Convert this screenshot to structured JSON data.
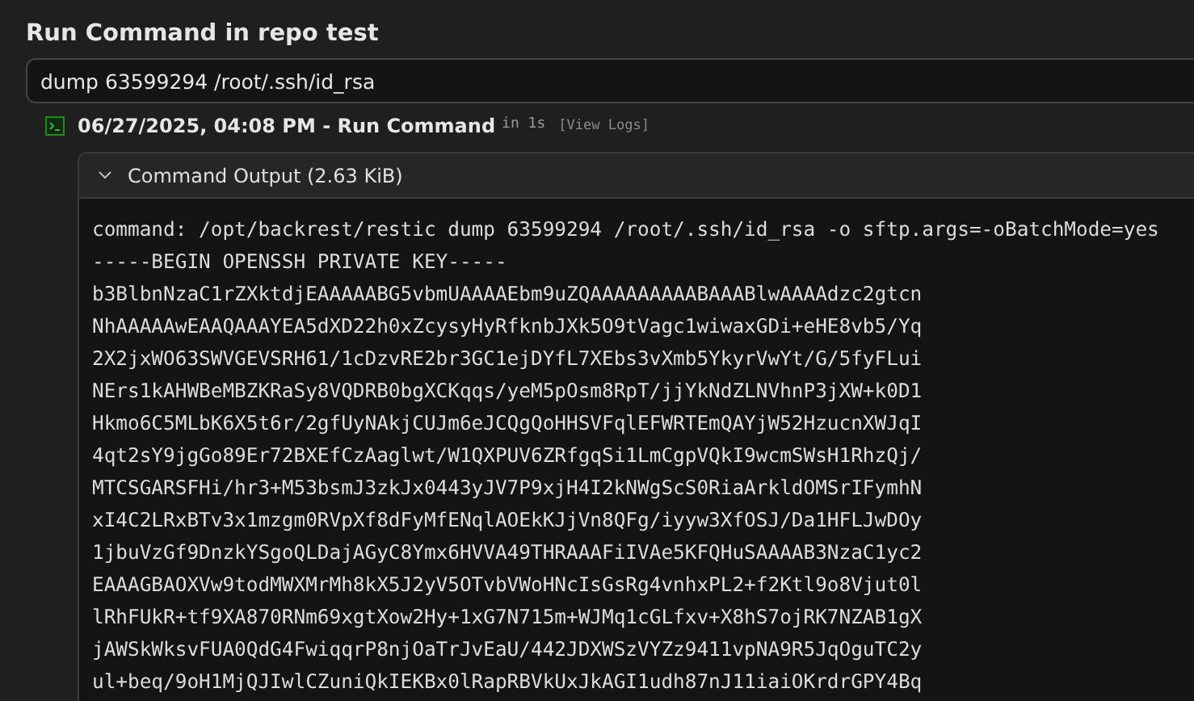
{
  "title": "Run Command in repo test",
  "command_field": {
    "value": "dump 63599294 /root/.ssh/id_rsa"
  },
  "operation": {
    "title": "06/27/2025, 04:08 PM - Run Command",
    "duration": "in 1s",
    "link": "[View Logs]"
  },
  "output_panel": {
    "label": "Command Output (2.63 KiB)",
    "expanded": true,
    "lines": [
      "command: /opt/backrest/restic dump 63599294 /root/.ssh/id_rsa -o sftp.args=-oBatchMode=yes",
      "-----BEGIN OPENSSH PRIVATE KEY-----",
      "b3BlbnNzaC1rZXktdjEAAAAABG5vbmUAAAAEbm9uZQAAAAAAAAABAAABlwAAAAdzc2gtcn",
      "NhAAAAAwEAAQAAAYEA5dXD22h0xZcysyHyRfknbJXk5O9tVagc1wiwaxGDi+eHE8vb5/Yq",
      "2X2jxWO63SWVGEVSRH61/1cDzvRE2br3GC1ejDYfL7XEbs3vXmb5YkyrVwYt/G/5fyFLui",
      "NErs1kAHWBeMBZKRaSy8VQDRB0bgXCKqqs/yeM5pOsm8RpT/jjYkNdZLNVhnP3jXW+k0D1",
      "Hkmo6C5MLbK6X5t6r/2gfUyNAkjCUJm6eJCQgQoHHSVFqlEFWRTEmQAYjW52HzucnXWJqI",
      "4qt2sY9jgGo89Er72BXEfCzAaglwt/W1QXPUV6ZRfgqSi1LmCgpVQkI9wcmSWsH1RhzQj/",
      "MTCSGARSFHi/hr3+M53bsmJ3zkJx0443yJV7P9xjH4I2kNWgScS0RiaArkldOMSrIFymhN",
      "xI4C2LRxBTv3x1mzgm0RVpXf8dFyMfENqlAOEkKJjVn8QFg/iyyw3XfOSJ/Da1HFLJwDOy",
      "1jbuVzGf9DnzkYSgoQLDajAGyC8Ymx6HVVA49THRAAAFiIVAe5KFQHuSAAAAB3NzaC1yc2",
      "EAAAGBAOXVw9todMWXMrMh8kX5J2yV5OTvbVWoHNcIsGsRg4vnhxPL2+f2Ktl9o8Vjut0l",
      "lRhFUkR+tf9XA870RNm69xgtXow2Hy+1xG7N715m+WJMq1cGLfxv+X8hS7ojRK7NZAB1gX",
      "jAWSkWksvFUA0QdG4FwiqqrP8njOaTrJvEaU/442JDXWSzVYZz9411vpNA9R5JqOguTC2y",
      "ul+beq/9oH1MjQJIwlCZuniQkIEKBx0lRapRBVkUxJkAGI1udh87nJ11iaiOKrdrGPY4Bq"
    ]
  }
}
